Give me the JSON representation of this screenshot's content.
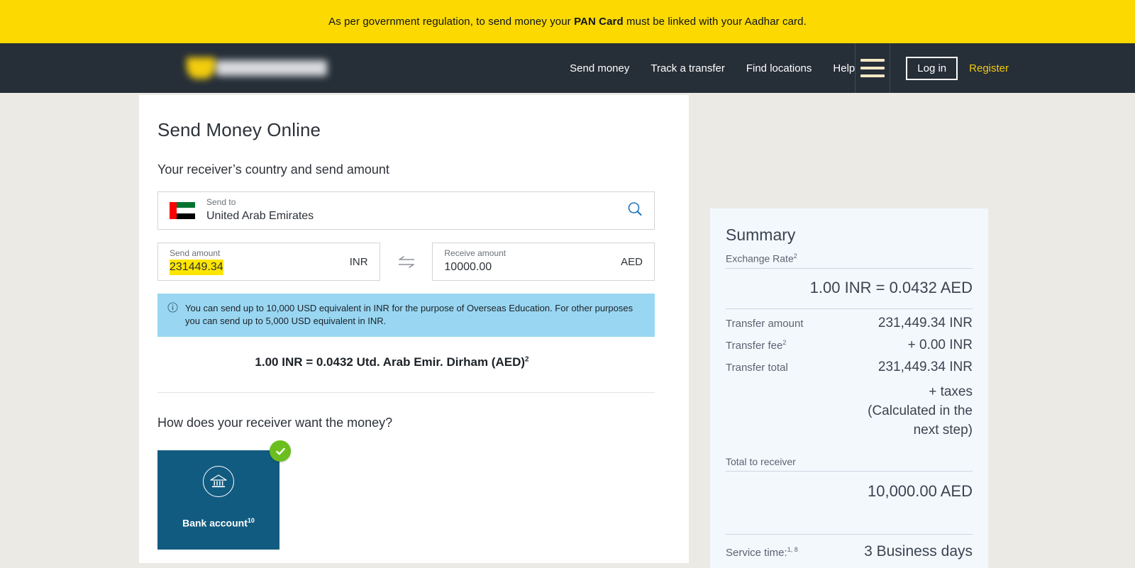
{
  "banner": {
    "text_before": "As per government regulation, to send money your ",
    "text_bold": "PAN Card",
    "text_after": " must be linked with your Aadhar card."
  },
  "nav": {
    "links": [
      {
        "label": "Send money"
      },
      {
        "label": "Track a transfer"
      },
      {
        "label": "Find locations"
      },
      {
        "label": "Help"
      }
    ],
    "login_label": "Log in",
    "register_label": "Register",
    "menu_icon": "hamburger-icon"
  },
  "main": {
    "page_title": "Send Money Online",
    "section_title": "Your receiver’s country and send amount",
    "send_to": {
      "label": "Send to",
      "value": "United Arab Emirates",
      "flag": "uae-flag-icon",
      "search_icon": "search-icon"
    },
    "send_amount": {
      "label": "Send amount",
      "value": "231449.34",
      "currency": "INR"
    },
    "receive_amount": {
      "label": "Receive amount",
      "value": "10000.00",
      "currency": "AED"
    },
    "swap_icon": "swap-arrows-icon",
    "info": {
      "icon": "info-circle-icon",
      "message": "You can send up to 10,000 USD equivalent in INR for the purpose of Overseas Education. For other purposes you can send up to 5,000 USD equivalent in INR."
    },
    "rate_line": {
      "text": "1.00 INR = 0.0432 Utd. Arab Emir. Dirham (AED)",
      "footnote": "2"
    },
    "receiver_question": "How does your receiver want the money?",
    "payout_options": [
      {
        "label": "Bank account",
        "footnote": "10",
        "icon": "bank-icon",
        "selected": true,
        "selected_icon": "check-circle-icon"
      }
    ]
  },
  "summary": {
    "title": "Summary",
    "exchange_rate_label": "Exchange Rate",
    "exchange_rate_footnote": "2",
    "exchange_rate_value": "1.00 INR = 0.0432 AED",
    "transfer_amount_label": "Transfer amount",
    "transfer_amount_value": "231,449.34 INR",
    "transfer_fee_label": "Transfer fee",
    "transfer_fee_footnote": "2",
    "transfer_fee_value": "+ 0.00 INR",
    "transfer_total_label": "Transfer total",
    "transfer_total_value": "231,449.34 INR",
    "taxes_line": "+ taxes",
    "taxes_note_line1": "(Calculated in the",
    "taxes_note_line2": "next step)",
    "total_to_receiver_label": "Total to receiver",
    "total_to_receiver_value": "10,000.00 AED",
    "service_time_label": "Service time:",
    "service_time_footnote": "1, 8",
    "service_time_value": "3 Business days"
  },
  "colors": {
    "banner_yellow": "#fcd900",
    "nav_dark": "#262e38",
    "page_bg": "#eceae5",
    "accent_yellow": "#f2cc0d",
    "info_blue": "#99d6f2",
    "payout_blue": "#125b80",
    "check_green": "#6abf1e",
    "summary_bg": "#f3f8fd",
    "link_blue": "#1e74bb"
  }
}
